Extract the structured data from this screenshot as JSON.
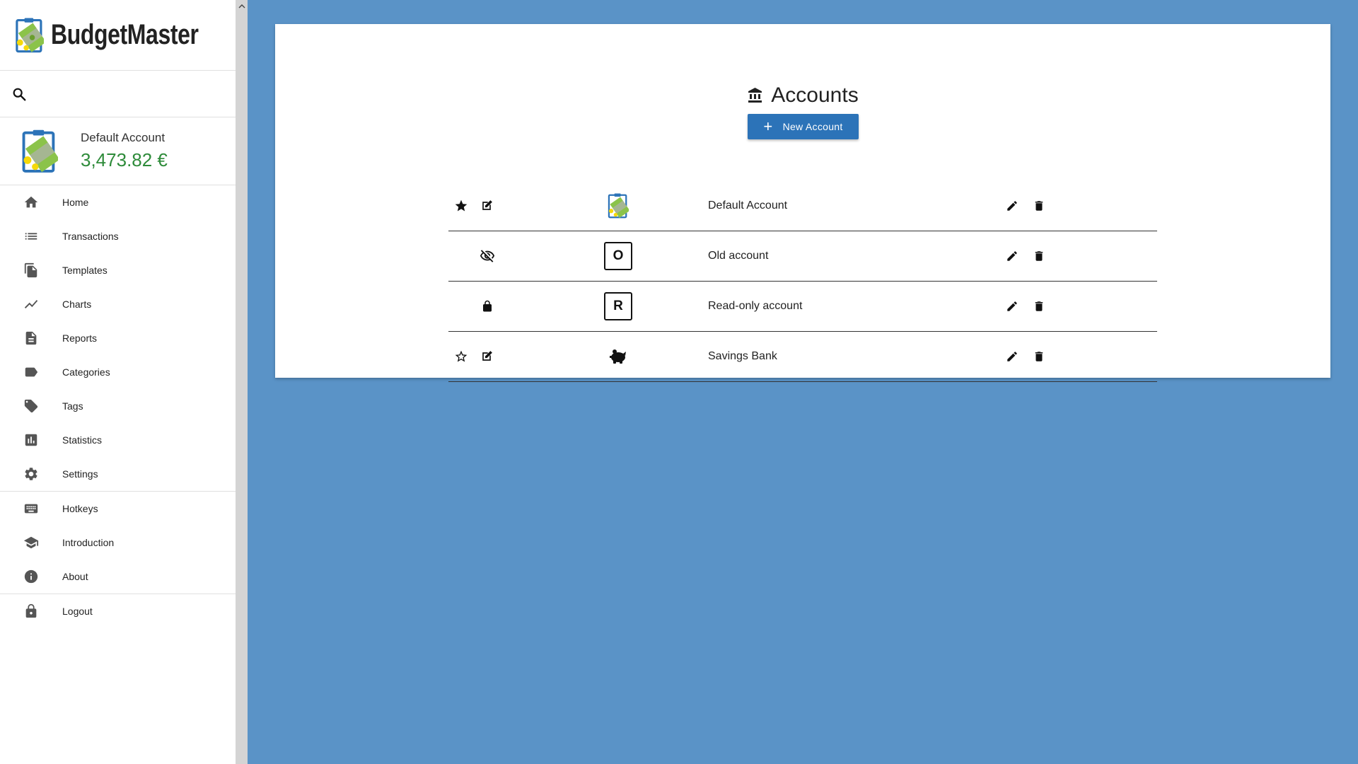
{
  "app": {
    "name": "BudgetMaster"
  },
  "sidebar": {
    "current_account": {
      "name": "Default Account",
      "balance": "3,473.82 €"
    },
    "nav_main": [
      {
        "label": "Home",
        "icon": "home-icon"
      },
      {
        "label": "Transactions",
        "icon": "list-icon"
      },
      {
        "label": "Templates",
        "icon": "file-copy-icon"
      },
      {
        "label": "Charts",
        "icon": "line-chart-icon"
      },
      {
        "label": "Reports",
        "icon": "description-icon"
      },
      {
        "label": "Categories",
        "icon": "label-icon"
      },
      {
        "label": "Tags",
        "icon": "tag-icon"
      },
      {
        "label": "Statistics",
        "icon": "bar-chart-icon"
      },
      {
        "label": "Settings",
        "icon": "gear-icon"
      }
    ],
    "nav_help": [
      {
        "label": "Hotkeys",
        "icon": "keyboard-icon"
      },
      {
        "label": "Introduction",
        "icon": "school-icon"
      },
      {
        "label": "About",
        "icon": "info-icon"
      }
    ],
    "nav_logout": {
      "label": "Logout",
      "icon": "lock-icon"
    }
  },
  "main": {
    "title": "Accounts",
    "title_icon": "bank-icon",
    "new_account_button": "New Account",
    "accounts": [
      {
        "name": "Default Account",
        "state": "default",
        "icon_type": "image",
        "icon_letter": ""
      },
      {
        "name": "Old account",
        "state": "hidden",
        "icon_type": "letter",
        "icon_letter": "O"
      },
      {
        "name": "Read-only account",
        "state": "read-only",
        "icon_type": "letter",
        "icon_letter": "R"
      },
      {
        "name": "Savings Bank",
        "state": "normal",
        "icon_type": "piggy-bank",
        "icon_letter": ""
      }
    ]
  },
  "colors": {
    "background": "#5a93c7",
    "primary_button": "#2c73b8",
    "balance_green": "#2e8b3a"
  }
}
